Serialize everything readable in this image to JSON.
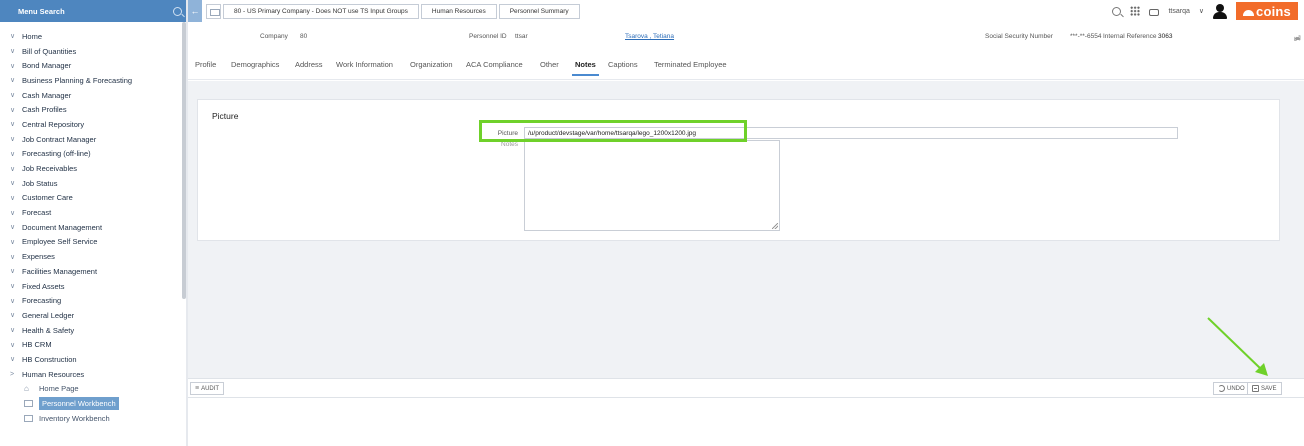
{
  "sidebar": {
    "search_label": "Menu Search",
    "items": [
      {
        "chev": "∨",
        "label": "Home"
      },
      {
        "chev": "∨",
        "label": "Bill of Quantities"
      },
      {
        "chev": "∨",
        "label": "Bond Manager"
      },
      {
        "chev": "∨",
        "label": "Business Planning & Forecasting"
      },
      {
        "chev": "∨",
        "label": "Cash Manager"
      },
      {
        "chev": "∨",
        "label": "Cash Profiles"
      },
      {
        "chev": "∨",
        "label": "Central Repository"
      },
      {
        "chev": "∨",
        "label": "Job Contract Manager"
      },
      {
        "chev": "∨",
        "label": "Forecasting (off-line)"
      },
      {
        "chev": "∨",
        "label": "Job Receivables"
      },
      {
        "chev": "∨",
        "label": "Job Status"
      },
      {
        "chev": "∨",
        "label": "Customer Care"
      },
      {
        "chev": "∨",
        "label": "Forecast"
      },
      {
        "chev": "∨",
        "label": "Document Management"
      },
      {
        "chev": "∨",
        "label": "Employee Self Service"
      },
      {
        "chev": "∨",
        "label": "Expenses"
      },
      {
        "chev": "∨",
        "label": "Facilities Management"
      },
      {
        "chev": "∨",
        "label": "Fixed Assets"
      },
      {
        "chev": "∨",
        "label": "Forecasting"
      },
      {
        "chev": "∨",
        "label": "General Ledger"
      },
      {
        "chev": "∨",
        "label": "Health & Safety"
      },
      {
        "chev": "∨",
        "label": "HB CRM"
      },
      {
        "chev": "∨",
        "label": "HB Construction"
      },
      {
        "chev": ">",
        "label": "Human Resources"
      }
    ],
    "sub_items": [
      {
        "label": "Home Page"
      },
      {
        "label": "Personnel Workbench"
      },
      {
        "label": "Inventory Workbench"
      }
    ]
  },
  "breadcrumbs": [
    "80 - US Primary Company - Does NOT use TS Input Groups",
    "Human Resources",
    "Personnel Summary"
  ],
  "topbar": {
    "user": "ttsarqa",
    "caret": "∨",
    "logo": "coins",
    "accent_color": "#f26c2a"
  },
  "record": {
    "company_label": "Company",
    "company_value": "80",
    "personnel_label": "Personnel ID",
    "personnel_value": "ttsar",
    "name_link": "Tsarova , Tetiana",
    "ssn_label": "Social Security Number",
    "ssn_value": "***-**-6554",
    "ref_label": "Internal Reference",
    "ref_value": "3063"
  },
  "tabs": [
    "Profile",
    "Demographics",
    "Address",
    "Work Information",
    "Organization",
    "ACA Compliance",
    "Other",
    "Notes",
    "Captions",
    "Terminated Employee"
  ],
  "panel": {
    "title": "Picture",
    "picture_label": "Picture",
    "picture_value": "/u/product/devstage/var/home/ttsarqa/lego_1200x1200.jpg",
    "notes_label": "Notes"
  },
  "toolbar": {
    "audit": "AUDIT",
    "undo": "UNDO",
    "save": "SAVE"
  },
  "annotation_color": "#6fd12a"
}
